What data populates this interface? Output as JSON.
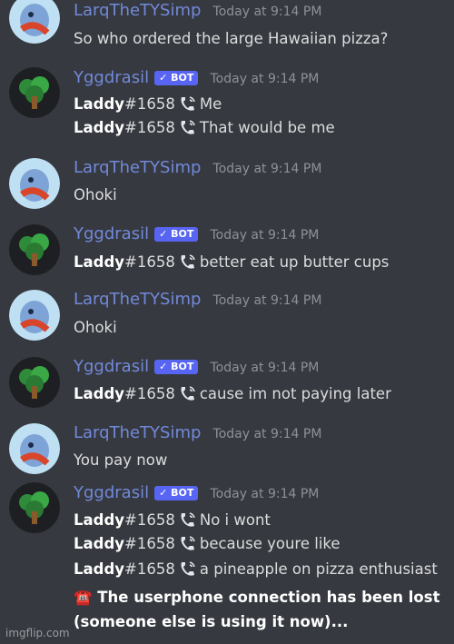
{
  "users": {
    "larq": {
      "name": "LarqTheTYSimp"
    },
    "ygg": {
      "name": "Yggdrasil",
      "badge": "✓ BOT"
    }
  },
  "timestamp": "Today at 9:14 PM",
  "messages": [
    {
      "author": "larq",
      "lines": [
        "So who ordered the large Hawaiian pizza?"
      ]
    },
    {
      "author": "ygg",
      "lines": [
        {
          "user": "Laddy",
          "tag": "#1658",
          "text": "Me"
        },
        {
          "user": "Laddy",
          "tag": "#1658",
          "text": "That would be me"
        }
      ]
    },
    {
      "author": "larq",
      "lines": [
        "Ohoki"
      ]
    },
    {
      "author": "ygg",
      "lines": [
        {
          "user": "Laddy",
          "tag": "#1658",
          "text": "better eat up butter cups"
        }
      ]
    },
    {
      "author": "larq",
      "lines": [
        "Ohoki"
      ]
    },
    {
      "author": "ygg",
      "lines": [
        {
          "user": "Laddy",
          "tag": "#1658",
          "text": "cause im not paying later"
        }
      ]
    },
    {
      "author": "larq",
      "lines": [
        "You pay now"
      ]
    },
    {
      "author": "ygg",
      "lines": [
        {
          "user": "Laddy",
          "tag": "#1658",
          "text": "No i wont"
        },
        {
          "user": "Laddy",
          "tag": "#1658",
          "text": "because youre like"
        },
        {
          "user": "Laddy",
          "tag": "#1658",
          "text": "a pineapple on pizza enthusiast"
        }
      ],
      "system": [
        "☎️ The userphone connection has been lost",
        "(someone else is using it now)..."
      ]
    }
  ],
  "watermark": "imgflip.com",
  "colors": {
    "background": "#36393f",
    "username": "#7289da",
    "badge": "#5865f2"
  }
}
